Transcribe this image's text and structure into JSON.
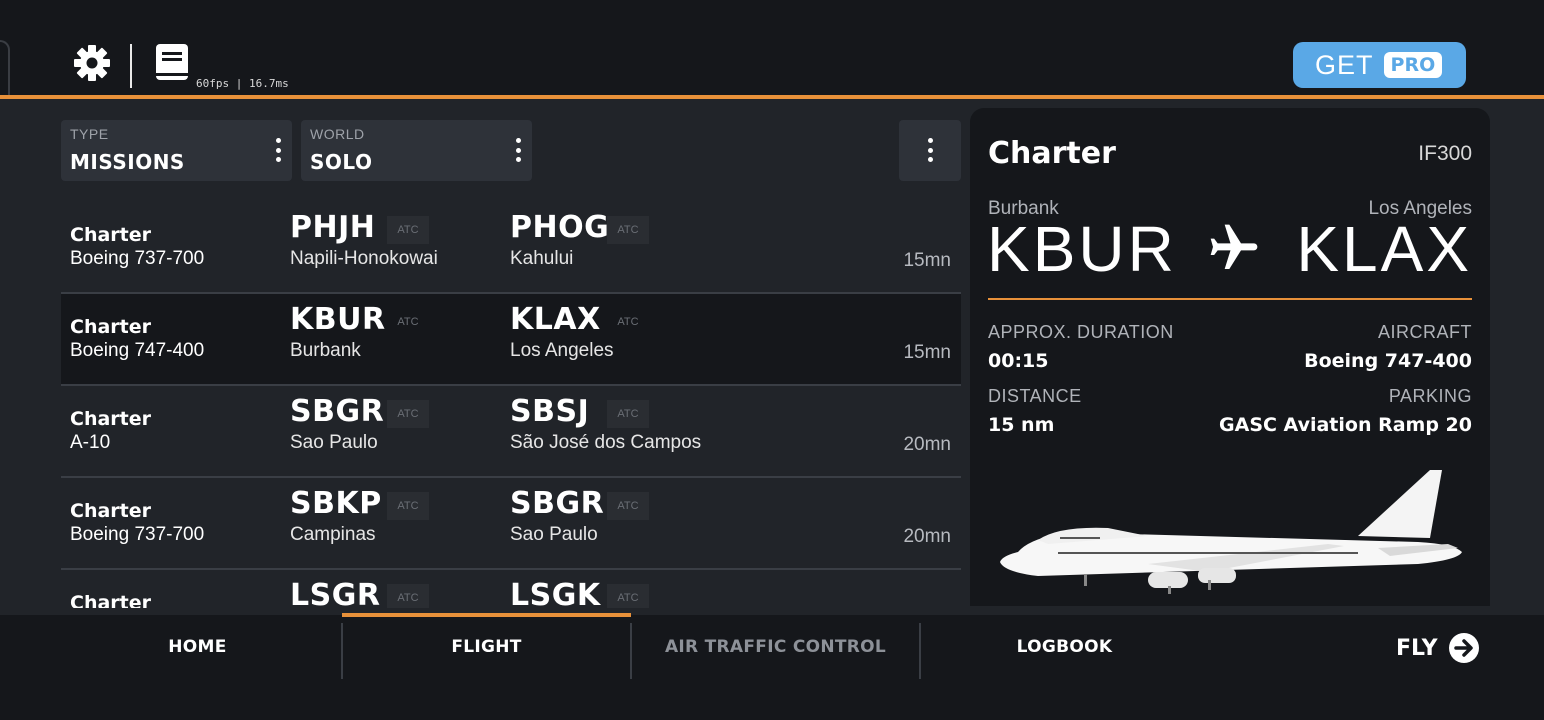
{
  "header": {
    "fps": "60fps | 16.7ms",
    "get_label": "GET",
    "pro_label": "PRO",
    "accent": "#e8913a",
    "pro_color": "#5aa8e6"
  },
  "filters": {
    "type": {
      "label": "TYPE",
      "value": "MISSIONS"
    },
    "world": {
      "label": "WORLD",
      "value": "SOLO"
    }
  },
  "missions": [
    {
      "type": "Charter",
      "aircraft": "Boeing 737-700",
      "from_code": "PHJH",
      "from_city": "Napili-Honokowai",
      "to_code": "PHOG",
      "to_city": "Kahului",
      "atc": "ATC",
      "duration": "15mn"
    },
    {
      "type": "Charter",
      "aircraft": "Boeing 747-400",
      "from_code": "KBUR",
      "from_city": "Burbank",
      "to_code": "KLAX",
      "to_city": "Los Angeles",
      "atc": "ATC",
      "duration": "15mn"
    },
    {
      "type": "Charter",
      "aircraft": "A-10",
      "from_code": "SBGR",
      "from_city": "Sao Paulo",
      "to_code": "SBSJ",
      "to_city": "São José dos Campos",
      "atc": "ATC",
      "duration": "20mn"
    },
    {
      "type": "Charter",
      "aircraft": "Boeing 737-700",
      "from_code": "SBKP",
      "from_city": "Campinas",
      "to_code": "SBGR",
      "to_city": "Sao Paulo",
      "atc": "ATC",
      "duration": "20mn"
    },
    {
      "type": "Charter",
      "aircraft": "",
      "from_code": "LSGR",
      "from_city": "",
      "to_code": "LSGK",
      "to_city": "",
      "atc": "ATC",
      "duration": ""
    }
  ],
  "detail": {
    "title": "Charter",
    "code": "IF300",
    "from_city": "Burbank",
    "from_code": "KBUR",
    "to_city": "Los Angeles",
    "to_code": "KLAX",
    "duration_label": "APPROX. DURATION",
    "duration_value": "00:15",
    "aircraft_label": "AIRCRAFT",
    "aircraft_value": "Boeing 747-400",
    "distance_label": "DISTANCE",
    "distance_value": "15 nm",
    "parking_label": "PARKING",
    "parking_value": "GASC Aviation Ramp 20"
  },
  "nav": {
    "home": "HOME",
    "flight": "FLIGHT",
    "atc": "AIR TRAFFIC CONTROL",
    "logbook": "LOGBOOK",
    "fly": "FLY",
    "active": "flight"
  }
}
